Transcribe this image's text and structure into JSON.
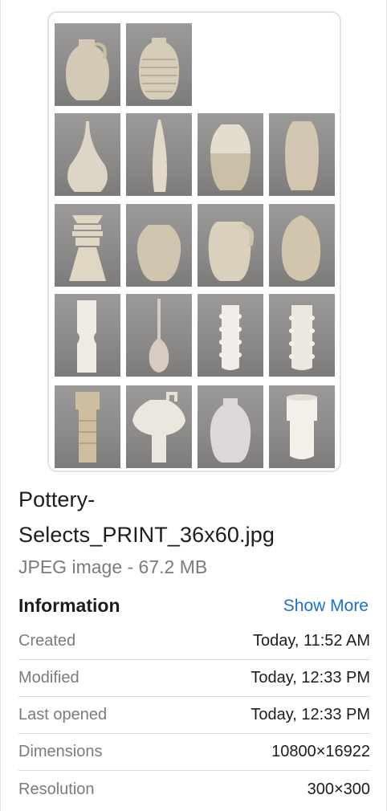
{
  "preview": {
    "image_alt": "Pottery selects print preview",
    "background_color": "#8f8d8b",
    "vase_color": "#d9d2c4"
  },
  "file": {
    "name_line1": "Pottery-",
    "name_line2": "Selects_PRINT_36x60.jpg",
    "kind_size": "JPEG image - 67.2 MB"
  },
  "info": {
    "header": "Information",
    "show_more": "Show More",
    "rows": [
      {
        "label": "Created",
        "value": "Today, 11:52 AM"
      },
      {
        "label": "Modified",
        "value": "Today, 12:33 PM"
      },
      {
        "label": "Last opened",
        "value": "Today, 12:33 PM"
      },
      {
        "label": "Dimensions",
        "value": "10800×16922"
      },
      {
        "label": "Resolution",
        "value": "300×300"
      }
    ]
  },
  "colors": {
    "accent": "#1a6fd4",
    "secondary_text": "#7b7b7f"
  }
}
